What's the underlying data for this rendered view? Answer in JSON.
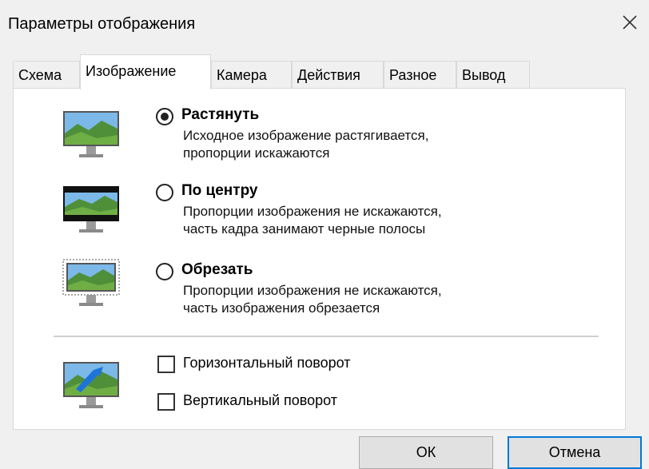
{
  "dialog": {
    "title": "Параметры отображения",
    "close_symbol": "×"
  },
  "tabs": [
    {
      "label": "Схема",
      "active": false
    },
    {
      "label": "Изображение",
      "active": true
    },
    {
      "label": "Камера",
      "active": false
    },
    {
      "label": "Действия",
      "active": false
    },
    {
      "label": "Разное",
      "active": false
    },
    {
      "label": "Вывод",
      "active": false
    }
  ],
  "options": [
    {
      "label": "Растянуть",
      "desc1": "Исходное изображение растягивается,",
      "desc2": "пропорции искажаются",
      "selected": true,
      "icon": "monitor-stretch-icon"
    },
    {
      "label": "По центру",
      "desc1": "Пропорции изображения не искажаются,",
      "desc2": "часть кадра занимают черные полосы",
      "selected": false,
      "icon": "monitor-center-icon"
    },
    {
      "label": "Обрезать",
      "desc1": "Пропорции изображения не искажаются,",
      "desc2": "часть изображения обрезается",
      "selected": false,
      "icon": "monitor-crop-icon"
    }
  ],
  "flip": {
    "horizontal_label": "Горизонтальный поворот",
    "vertical_label": "Вертикальный поворот",
    "horizontal_checked": false,
    "vertical_checked": false,
    "icon": "monitor-flip-icon"
  },
  "buttons": {
    "ok": "ОК",
    "cancel": "Отмена"
  },
  "colors": {
    "accent": "#0078d7",
    "panel": "#ffffff",
    "window": "#f0f0f0"
  }
}
